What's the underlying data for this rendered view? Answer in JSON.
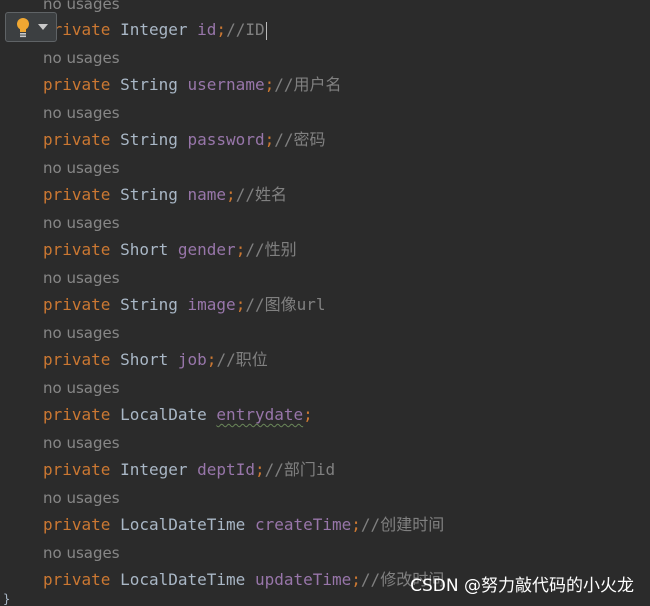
{
  "editor": {
    "usage_hint": "no usages",
    "keyword": "private",
    "lines": [
      {
        "type": "Integer",
        "field": "id",
        "semicolon": ";",
        "comment": "//ID"
      },
      {
        "type": "String",
        "field": "username",
        "semicolon": ";",
        "comment": "//用户名"
      },
      {
        "type": "String",
        "field": "password",
        "semicolon": ";",
        "comment": "//密码"
      },
      {
        "type": "String",
        "field": "name",
        "semicolon": ";",
        "comment": "//姓名"
      },
      {
        "type": "Short",
        "field": "gender",
        "semicolon": ";",
        "comment": "//性别"
      },
      {
        "type": "String",
        "field": "image",
        "semicolon": ";",
        "comment": "//图像url"
      },
      {
        "type": "Short",
        "field": "job",
        "semicolon": ";",
        "comment": "//职位"
      },
      {
        "type": "LocalDate",
        "field": "entrydate",
        "semicolon": ";",
        "comment": ""
      },
      {
        "type": "Integer",
        "field": "deptId",
        "semicolon": ";",
        "comment": "//部门id"
      },
      {
        "type": "LocalDateTime",
        "field": "createTime",
        "semicolon": ";",
        "comment": "//创建时间"
      },
      {
        "type": "LocalDateTime",
        "field": "updateTime",
        "semicolon": ";",
        "comment": "//修改时间"
      }
    ],
    "closing_brace": "}"
  },
  "intention_actions": {
    "icon": "lightbulb-icon",
    "dropdown_icon": "chevron-down-icon"
  },
  "watermark": "CSDN @努力敲代码的小火龙",
  "colors": {
    "background": "#2b2b2b",
    "keyword": "#cc7832",
    "type": "#a9b7c6",
    "field": "#9876aa",
    "comment": "#808080",
    "hint": "#878787"
  }
}
